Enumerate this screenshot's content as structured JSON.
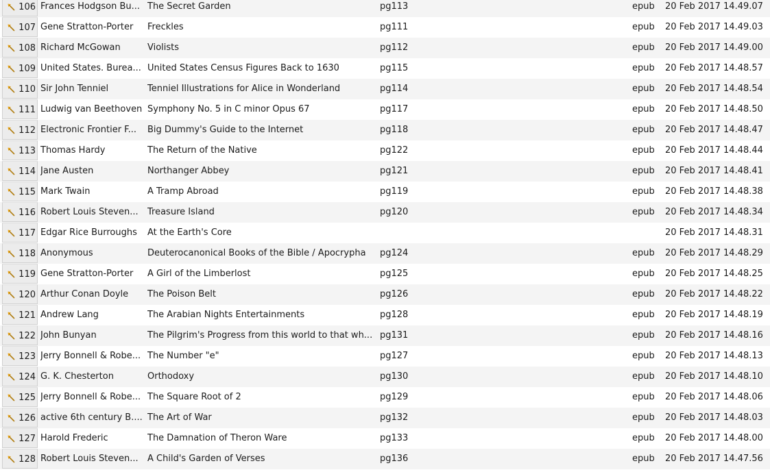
{
  "accent_color": "#e8a317",
  "rows": [
    {
      "num": "106",
      "author": "Frances Hodgson Bu...",
      "title": "The Secret Garden",
      "id": "pg113",
      "format": "epub",
      "date": "20 Feb 2017 14.49.07"
    },
    {
      "num": "107",
      "author": "Gene Stratton-Porter",
      "title": "Freckles",
      "id": "pg111",
      "format": "epub",
      "date": "20 Feb 2017 14.49.03"
    },
    {
      "num": "108",
      "author": "Richard McGowan",
      "title": "Violists",
      "id": "pg112",
      "format": "epub",
      "date": "20 Feb 2017 14.49.00"
    },
    {
      "num": "109",
      "author": "United States. Burea...",
      "title": "United States Census Figures Back to 1630",
      "id": "pg115",
      "format": "epub",
      "date": "20 Feb 2017 14.48.57"
    },
    {
      "num": "110",
      "author": "Sir John Tenniel",
      "title": "Tenniel Illustrations for Alice in Wonderland",
      "id": "pg114",
      "format": "epub",
      "date": "20 Feb 2017 14.48.54"
    },
    {
      "num": "111",
      "author": "Ludwig van Beethoven",
      "title": "Symphony No. 5 in C minor Opus 67",
      "id": "pg117",
      "format": "epub",
      "date": "20 Feb 2017 14.48.50"
    },
    {
      "num": "112",
      "author": "Electronic Frontier F...",
      "title": "Big Dummy's Guide to the Internet",
      "id": "pg118",
      "format": "epub",
      "date": "20 Feb 2017 14.48.47"
    },
    {
      "num": "113",
      "author": "Thomas Hardy",
      "title": "The Return of the Native",
      "id": "pg122",
      "format": "epub",
      "date": "20 Feb 2017 14.48.44"
    },
    {
      "num": "114",
      "author": "Jane Austen",
      "title": "Northanger Abbey",
      "id": "pg121",
      "format": "epub",
      "date": "20 Feb 2017 14.48.41"
    },
    {
      "num": "115",
      "author": "Mark Twain",
      "title": "A Tramp Abroad",
      "id": "pg119",
      "format": "epub",
      "date": "20 Feb 2017 14.48.38"
    },
    {
      "num": "116",
      "author": "Robert Louis Steven...",
      "title": "Treasure Island",
      "id": "pg120",
      "format": "epub",
      "date": "20 Feb 2017 14.48.34"
    },
    {
      "num": "117",
      "author": "Edgar Rice Burroughs",
      "title": "At the Earth's Core",
      "id": "",
      "format": "",
      "date": "20 Feb 2017 14.48.31"
    },
    {
      "num": "118",
      "author": "Anonymous",
      "title": "Deuterocanonical Books of the Bible / Apocrypha",
      "id": "pg124",
      "format": "epub",
      "date": "20 Feb 2017 14.48.29"
    },
    {
      "num": "119",
      "author": "Gene Stratton-Porter",
      "title": "A Girl of the Limberlost",
      "id": "pg125",
      "format": "epub",
      "date": "20 Feb 2017 14.48.25"
    },
    {
      "num": "120",
      "author": "Arthur Conan Doyle",
      "title": "The Poison Belt",
      "id": "pg126",
      "format": "epub",
      "date": "20 Feb 2017 14.48.22"
    },
    {
      "num": "121",
      "author": "Andrew Lang",
      "title": "The Arabian Nights Entertainments",
      "id": "pg128",
      "format": "epub",
      "date": "20 Feb 2017 14.48.19"
    },
    {
      "num": "122",
      "author": "John Bunyan",
      "title": "The Pilgrim's Progress from this world to that wh...",
      "id": "pg131",
      "format": "epub",
      "date": "20 Feb 2017 14.48.16"
    },
    {
      "num": "123",
      "author": "Jerry Bonnell & Robe...",
      "title": "The Number \"e\"",
      "id": "pg127",
      "format": "epub",
      "date": "20 Feb 2017 14.48.13"
    },
    {
      "num": "124",
      "author": "G. K. Chesterton",
      "title": "Orthodoxy",
      "id": "pg130",
      "format": "epub",
      "date": "20 Feb 2017 14.48.10"
    },
    {
      "num": "125",
      "author": "Jerry Bonnell & Robe...",
      "title": "The Square Root of 2",
      "id": "pg129",
      "format": "epub",
      "date": "20 Feb 2017 14.48.06"
    },
    {
      "num": "126",
      "author": "active 6th century B....",
      "title": "The Art of War",
      "id": "pg132",
      "format": "epub",
      "date": "20 Feb 2017 14.48.03"
    },
    {
      "num": "127",
      "author": "Harold Frederic",
      "title": "The Damnation of Theron Ware",
      "id": "pg133",
      "format": "epub",
      "date": "20 Feb 2017 14.48.00"
    },
    {
      "num": "128",
      "author": "Robert Louis Steven...",
      "title": "A Child's Garden of Verses",
      "id": "pg136",
      "format": "epub",
      "date": "20 Feb 2017 14.47.56"
    }
  ]
}
